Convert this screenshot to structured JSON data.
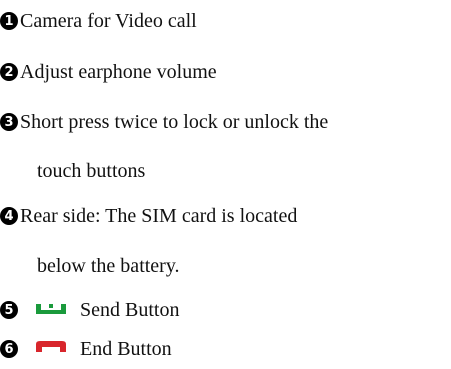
{
  "items": [
    {
      "number": "1",
      "text": "Camera for Video call"
    },
    {
      "number": "2",
      "text": "Adjust earphone volume"
    },
    {
      "number": "3",
      "text": "Short press twice to lock or unlock the",
      "continuation": "touch buttons"
    },
    {
      "number": "4",
      "text": "Rear side: The SIM card is located",
      "continuation": "below the battery."
    },
    {
      "number": "5",
      "icon": "send-call-icon",
      "icon_color": "#1a9a3c",
      "text": "Send Button"
    },
    {
      "number": "6",
      "icon": "end-call-icon",
      "icon_color": "#d8262c",
      "text": "End Button"
    }
  ]
}
